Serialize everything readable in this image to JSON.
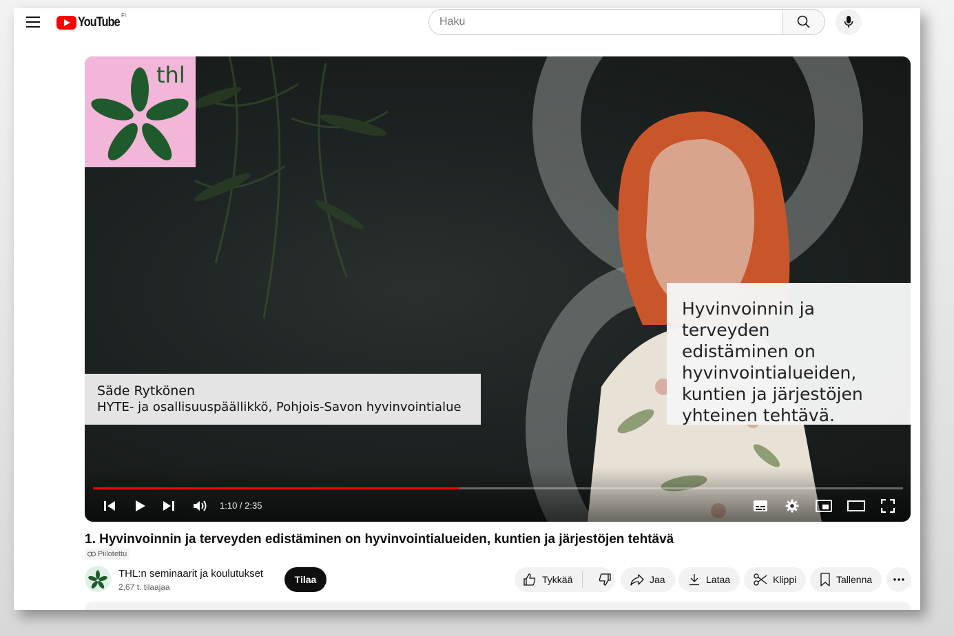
{
  "header": {
    "logo_text": "YouTube",
    "region": "FI",
    "search_placeholder": "Haku"
  },
  "video": {
    "logo_text": "thl",
    "speaker_name": "Säde Rytkönen",
    "speaker_role": "HYTE- ja osallisuuspäällikkö, Pohjois-Savon hyvinvointialue",
    "quote_lines": [
      "Hyvinvoinnin ja terveyden",
      "edistäminen on",
      "hyvinvointialueiden,",
      "kuntien ja järjestöjen",
      "yhteinen tehtävä."
    ],
    "time": "1:10 / 2:35",
    "progress_fraction": 0.452,
    "progress_color": "#ff0000"
  },
  "info": {
    "title": "1. Hyvinvoinnin ja terveyden edistäminen on hyvinvointialueiden, kuntien ja järjestöjen tehtävä",
    "privacy": "Piilotettu",
    "channel_name": "THL:n seminaarit ja koulutukset",
    "subscribers": "2,67 t. tilaajaa",
    "subscribe_label": "Tilaa"
  },
  "actions": {
    "like": "Tykkää",
    "share": "Jaa",
    "download": "Lataa",
    "clip": "Klippi",
    "save": "Tallenna"
  },
  "colors": {
    "accent": "#ff0000",
    "thl_pink": "#f2b6d9",
    "thl_green": "#1f5a2c"
  }
}
